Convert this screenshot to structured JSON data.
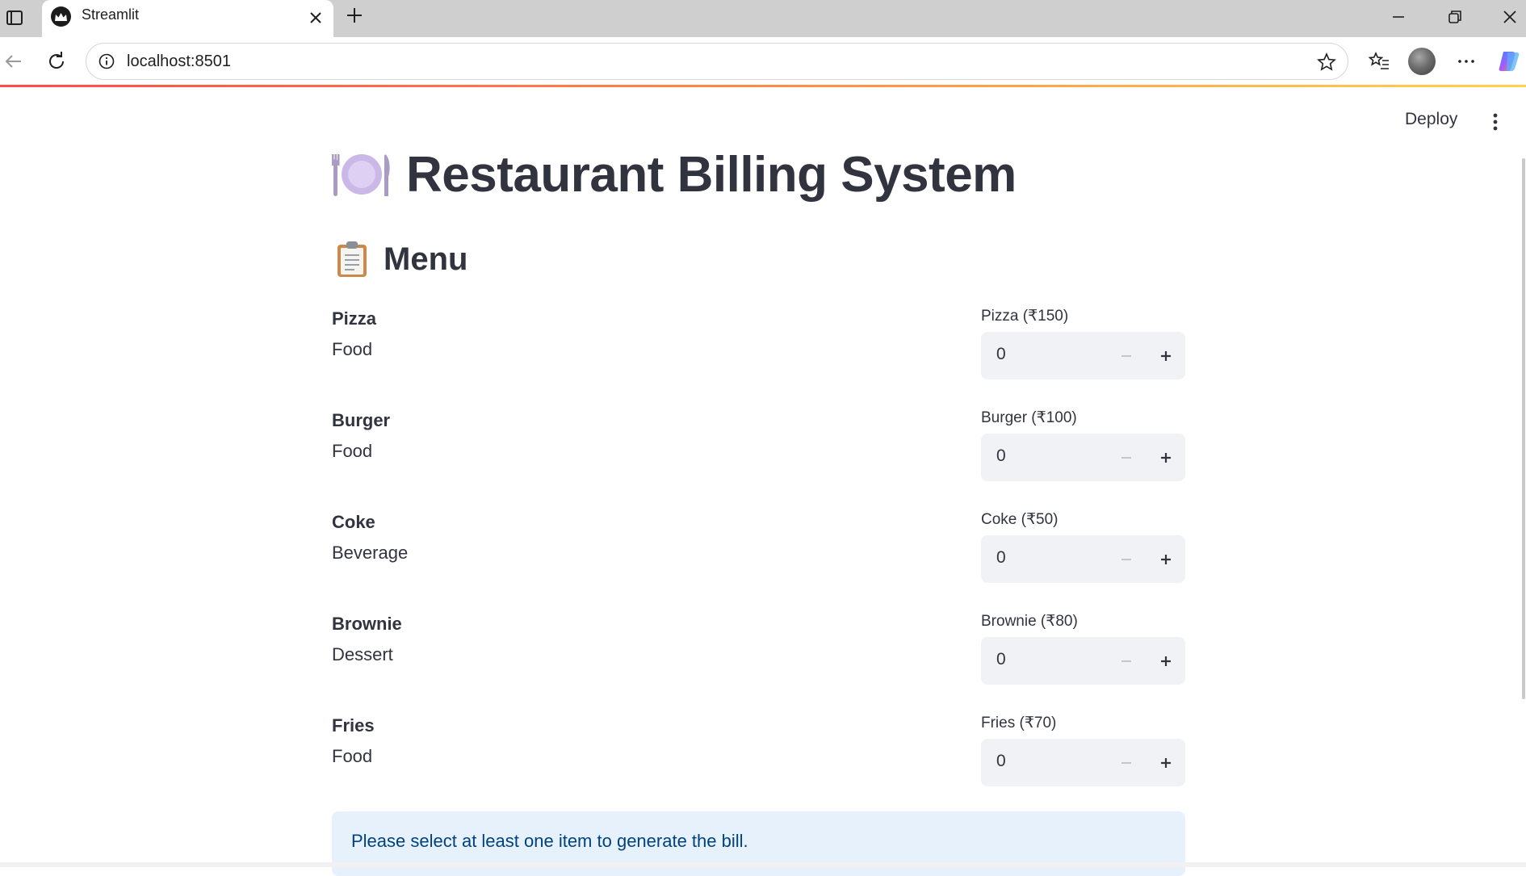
{
  "browser": {
    "tab_title": "Streamlit",
    "url": "localhost:8501"
  },
  "app": {
    "deploy_label": "Deploy",
    "title": "Restaurant Billing System",
    "title_icon": "plate-with-cutlery-icon",
    "menu_heading": "Menu",
    "menu_icon": "clipboard-icon",
    "items": [
      {
        "name": "Pizza",
        "category": "Food",
        "qty_label": "Pizza (₹150)",
        "qty": "0"
      },
      {
        "name": "Burger",
        "category": "Food",
        "qty_label": "Burger (₹100)",
        "qty": "0"
      },
      {
        "name": "Coke",
        "category": "Beverage",
        "qty_label": "Coke (₹50)",
        "qty": "0"
      },
      {
        "name": "Brownie",
        "category": "Dessert",
        "qty_label": "Brownie (₹80)",
        "qty": "0"
      },
      {
        "name": "Fries",
        "category": "Food",
        "qty_label": "Fries (₹70)",
        "qty": "0"
      }
    ],
    "info_message": "Please select at least one item to generate the bill."
  },
  "colors": {
    "text": "#31333f",
    "accent_progress": "#ff4b4b",
    "info_bg": "#e7f1fb",
    "info_text": "#004280",
    "input_bg": "#f0f2f6"
  }
}
